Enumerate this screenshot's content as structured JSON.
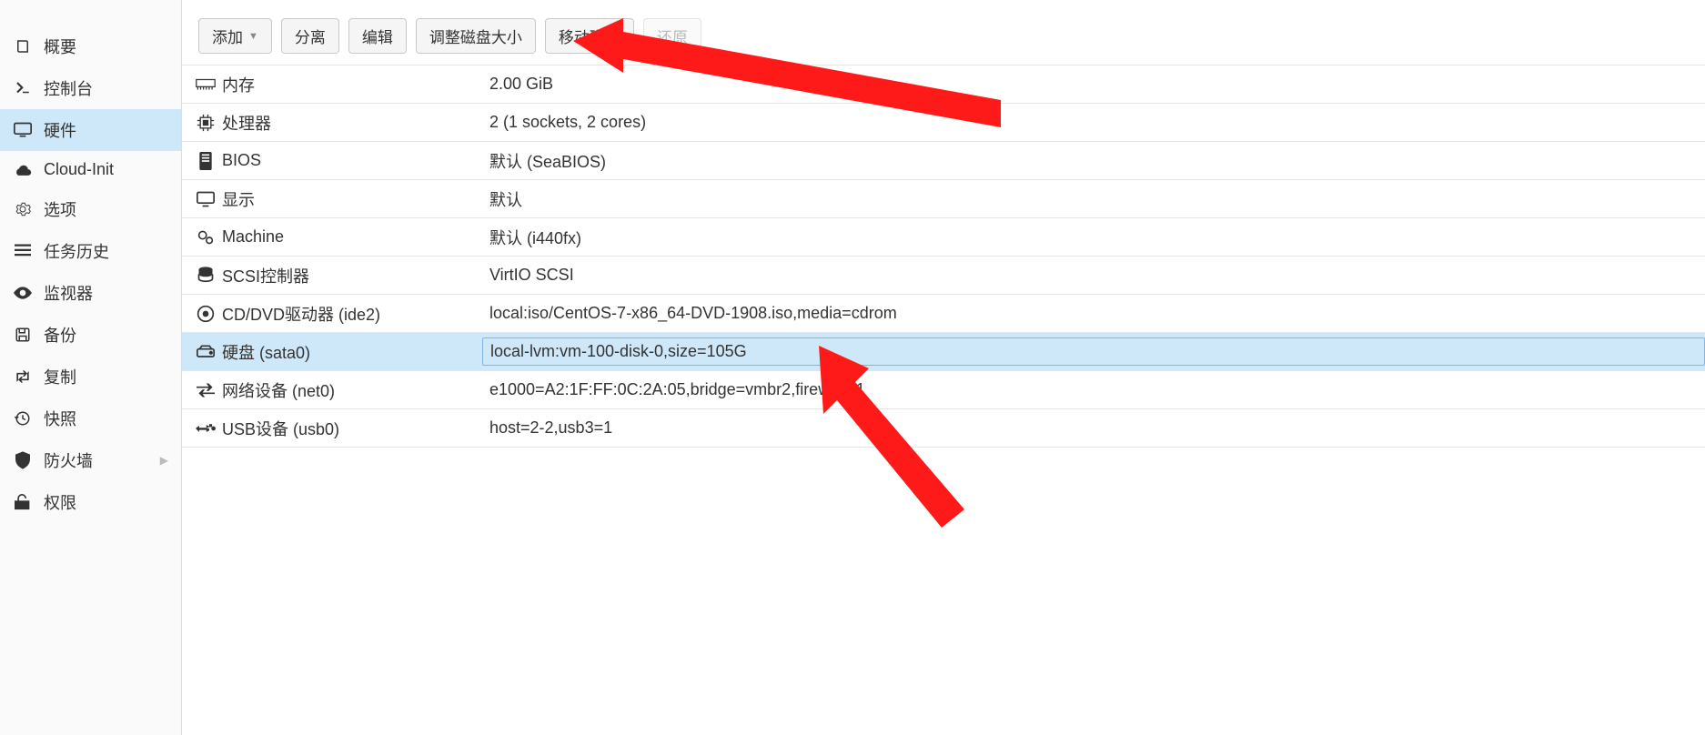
{
  "sidebar": {
    "items": [
      {
        "label": "概要",
        "icon": "book"
      },
      {
        "label": "控制台",
        "icon": "terminal"
      },
      {
        "label": "硬件",
        "icon": "monitor",
        "selected": true
      },
      {
        "label": "Cloud-Init",
        "icon": "cloud"
      },
      {
        "label": "选项",
        "icon": "gear"
      },
      {
        "label": "任务历史",
        "icon": "list"
      },
      {
        "label": "监视器",
        "icon": "eye"
      },
      {
        "label": "备份",
        "icon": "save"
      },
      {
        "label": "复制",
        "icon": "retweet"
      },
      {
        "label": "快照",
        "icon": "history"
      },
      {
        "label": "防火墙",
        "icon": "shield",
        "has_sub": true
      },
      {
        "label": "权限",
        "icon": "unlock"
      }
    ]
  },
  "toolbar": {
    "add": "添加",
    "detach": "分离",
    "edit": "编辑",
    "resize": "调整磁盘大小",
    "move": "移动磁盘",
    "restore": "还原"
  },
  "hardware": [
    {
      "icon": "memory",
      "key": "内存",
      "val": "2.00 GiB"
    },
    {
      "icon": "cpu",
      "key": "处理器",
      "val": "2 (1 sockets, 2 cores)"
    },
    {
      "icon": "bios",
      "key": "BIOS",
      "val": "默认 (SeaBIOS)"
    },
    {
      "icon": "display",
      "key": "显示",
      "val": "默认"
    },
    {
      "icon": "gears",
      "key": "Machine",
      "val": "默认 (i440fx)"
    },
    {
      "icon": "db",
      "key": "SCSI控制器",
      "val": "VirtIO SCSI"
    },
    {
      "icon": "disc",
      "key": "CD/DVD驱动器 (ide2)",
      "val": "local:iso/CentOS-7-x86_64-DVD-1908.iso,media=cdrom"
    },
    {
      "icon": "hdd",
      "key": "硬盘 (sata0)",
      "val": "local-lvm:vm-100-disk-0,size=105G",
      "selected": true
    },
    {
      "icon": "net",
      "key": "网络设备 (net0)",
      "val": "e1000=A2:1F:FF:0C:2A:05,bridge=vmbr2,firewall=1"
    },
    {
      "icon": "usb",
      "key": "USB设备 (usb0)",
      "val": "host=2-2,usb3=1"
    }
  ]
}
